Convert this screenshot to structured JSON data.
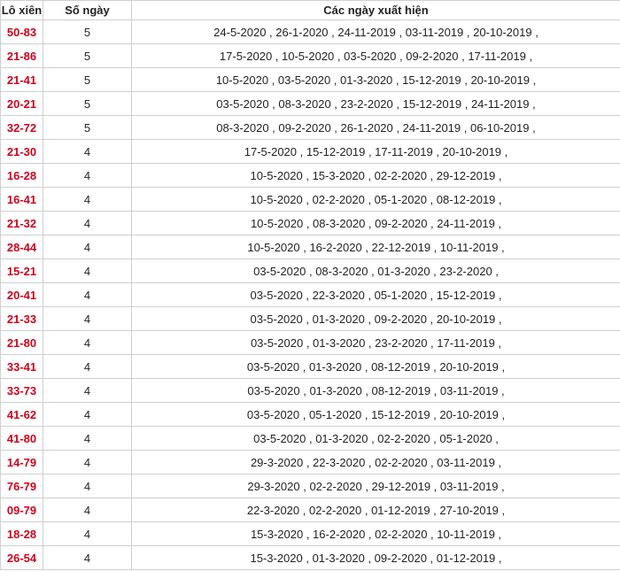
{
  "table": {
    "headers": {
      "pair": "Lô xiên",
      "count": "Số ngày",
      "dates": "Các ngày xuất hiện"
    },
    "rows": [
      {
        "pair": "50-83",
        "count": "5",
        "dates": "24-5-2020 , 26-1-2020 , 24-11-2019 , 03-11-2019 , 20-10-2019 ,"
      },
      {
        "pair": "21-86",
        "count": "5",
        "dates": "17-5-2020 , 10-5-2020 , 03-5-2020 , 09-2-2020 , 17-11-2019 ,"
      },
      {
        "pair": "21-41",
        "count": "5",
        "dates": "10-5-2020 , 03-5-2020 , 01-3-2020 , 15-12-2019 , 20-10-2019 ,"
      },
      {
        "pair": "20-21",
        "count": "5",
        "dates": "03-5-2020 , 08-3-2020 , 23-2-2020 , 15-12-2019 , 24-11-2019 ,"
      },
      {
        "pair": "32-72",
        "count": "5",
        "dates": "08-3-2020 , 09-2-2020 , 26-1-2020 , 24-11-2019 , 06-10-2019 ,"
      },
      {
        "pair": "21-30",
        "count": "4",
        "dates": "17-5-2020 , 15-12-2019 , 17-11-2019 , 20-10-2019 ,"
      },
      {
        "pair": "16-28",
        "count": "4",
        "dates": "10-5-2020 , 15-3-2020 , 02-2-2020 , 29-12-2019 ,"
      },
      {
        "pair": "16-41",
        "count": "4",
        "dates": "10-5-2020 , 02-2-2020 , 05-1-2020 , 08-12-2019 ,"
      },
      {
        "pair": "21-32",
        "count": "4",
        "dates": "10-5-2020 , 08-3-2020 , 09-2-2020 , 24-11-2019 ,"
      },
      {
        "pair": "28-44",
        "count": "4",
        "dates": "10-5-2020 , 16-2-2020 , 22-12-2019 , 10-11-2019 ,"
      },
      {
        "pair": "15-21",
        "count": "4",
        "dates": "03-5-2020 , 08-3-2020 , 01-3-2020 , 23-2-2020 ,"
      },
      {
        "pair": "20-41",
        "count": "4",
        "dates": "03-5-2020 , 22-3-2020 , 05-1-2020 , 15-12-2019 ,"
      },
      {
        "pair": "21-33",
        "count": "4",
        "dates": "03-5-2020 , 01-3-2020 , 09-2-2020 , 20-10-2019 ,"
      },
      {
        "pair": "21-80",
        "count": "4",
        "dates": "03-5-2020 , 01-3-2020 , 23-2-2020 , 17-11-2019 ,"
      },
      {
        "pair": "33-41",
        "count": "4",
        "dates": "03-5-2020 , 01-3-2020 , 08-12-2019 , 20-10-2019 ,"
      },
      {
        "pair": "33-73",
        "count": "4",
        "dates": "03-5-2020 , 01-3-2020 , 08-12-2019 , 03-11-2019 ,"
      },
      {
        "pair": "41-62",
        "count": "4",
        "dates": "03-5-2020 , 05-1-2020 , 15-12-2019 , 20-10-2019 ,"
      },
      {
        "pair": "41-80",
        "count": "4",
        "dates": "03-5-2020 , 01-3-2020 , 02-2-2020 , 05-1-2020 ,"
      },
      {
        "pair": "14-79",
        "count": "4",
        "dates": "29-3-2020 , 22-3-2020 , 02-2-2020 , 03-11-2019 ,"
      },
      {
        "pair": "76-79",
        "count": "4",
        "dates": "29-3-2020 , 02-2-2020 , 29-12-2019 , 03-11-2019 ,"
      },
      {
        "pair": "09-79",
        "count": "4",
        "dates": "22-3-2020 , 02-2-2020 , 01-12-2019 , 27-10-2019 ,"
      },
      {
        "pair": "18-28",
        "count": "4",
        "dates": "15-3-2020 , 16-2-2020 , 02-2-2020 , 10-11-2019 ,"
      },
      {
        "pair": "26-54",
        "count": "4",
        "dates": "15-3-2020 , 01-3-2020 , 09-2-2020 , 01-12-2019 ,"
      }
    ]
  },
  "colors": {
    "pair_text": "#d0021b",
    "border": "#cfcfcf",
    "text": "#222222"
  }
}
